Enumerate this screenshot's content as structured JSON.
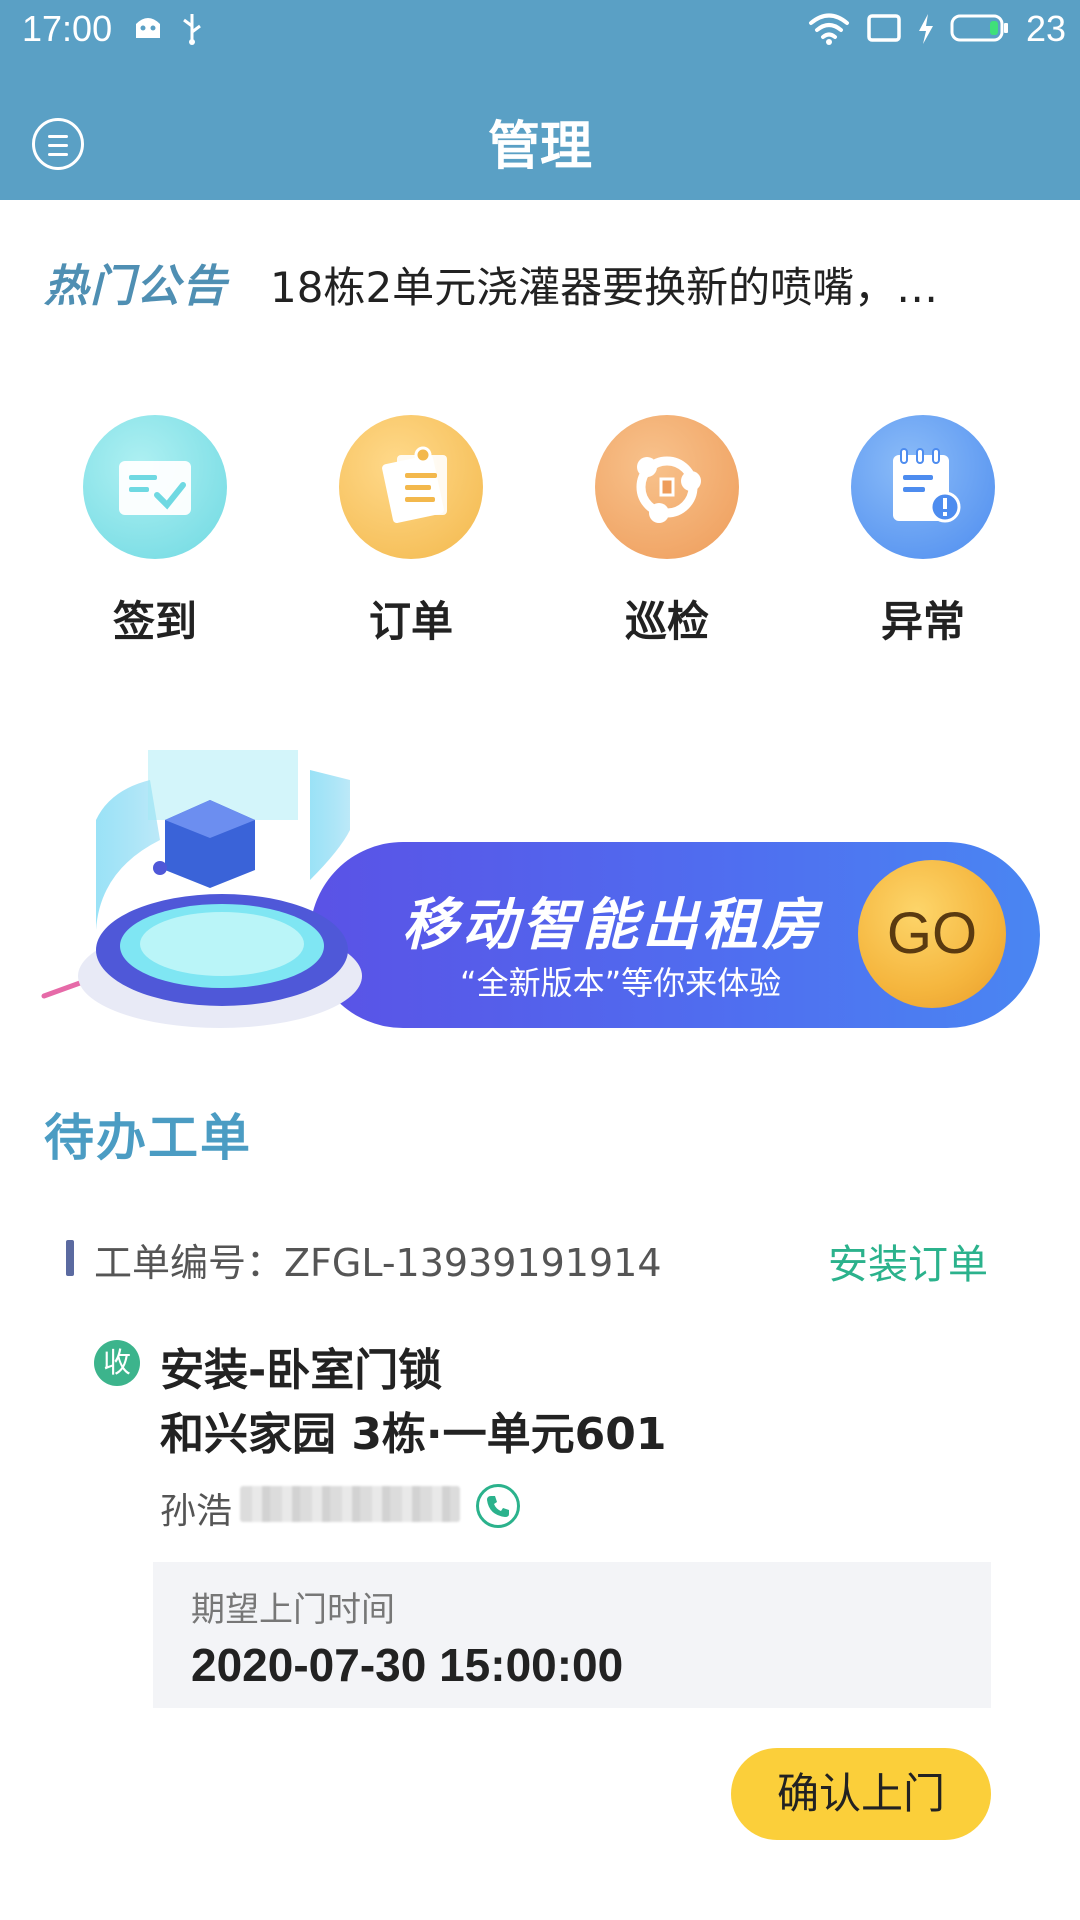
{
  "status_bar": {
    "time": "17:00",
    "battery_level": "23",
    "icons": [
      "android-icon",
      "usb-icon",
      "wifi-icon",
      "tablet-icon",
      "charging-icon",
      "battery-icon"
    ]
  },
  "header": {
    "title": "管理",
    "menu_icon": "menu-icon"
  },
  "notice": {
    "tag": "热门公告",
    "text": "18栋2单元浇灌器要换新的喷嘴，…"
  },
  "actions": [
    {
      "label": "签到",
      "icon": "checkin-icon",
      "color": "#7fe0e6"
    },
    {
      "label": "订单",
      "icon": "order-icon",
      "color": "#f6c15e"
    },
    {
      "label": "巡检",
      "icon": "patrol-icon",
      "color": "#f3a86a"
    },
    {
      "label": "异常",
      "icon": "exception-icon",
      "color": "#5b9cf1"
    }
  ],
  "banner": {
    "title": "移动智能出租房",
    "subtitle": "“全新版本”等你来体验",
    "go_label": "GO"
  },
  "section": {
    "title": "待办工单"
  },
  "order": {
    "number_label": "工单编号：ZFGL-13939191914",
    "type": "安装订单",
    "badge": "收",
    "item": "安装-卧室门锁",
    "address": "和兴家园 3栋·一单元601",
    "contact": "孙浩",
    "expected_time_label": "期望上门时间",
    "expected_time": "2020-07-30 15:00:00",
    "confirm_label": "确认上门"
  },
  "colors": {
    "header_bg": "#5aa0c5",
    "accent_teal": "#4b9cc3",
    "order_type_green": "#2bb28c",
    "confirm_yellow": "#fbcf3a"
  }
}
